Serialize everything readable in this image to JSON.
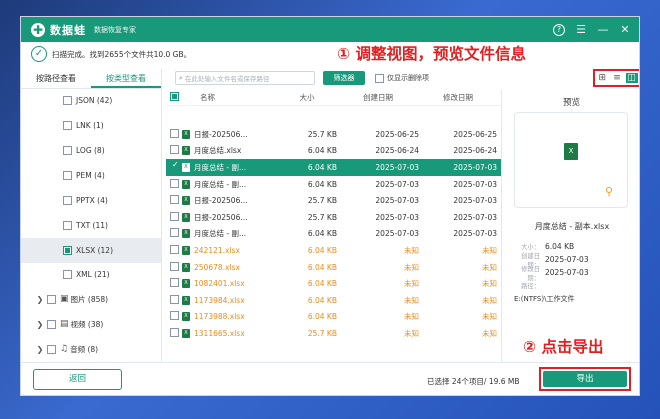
{
  "app": {
    "name": "数据蛙",
    "slogan": "数据恢复专家"
  },
  "scan": {
    "status": "扫描完成。找到2655个文件共10.0 GB。"
  },
  "annotations": {
    "step1": "① 调整视图，预览文件信息",
    "step2": "② 点击导出"
  },
  "left": {
    "tabs": [
      "按路径查看",
      "按类型查看"
    ],
    "items": [
      {
        "label": "JSON (42)"
      },
      {
        "label": "LNK (1)"
      },
      {
        "label": "LOG (8)"
      },
      {
        "label": "PEM (4)"
      },
      {
        "label": "PPTX (4)"
      },
      {
        "label": "TXT (11)"
      },
      {
        "label": "XLSX (12)"
      },
      {
        "label": "XML (21)"
      },
      {
        "label": "图片 (858)"
      },
      {
        "label": "视频 (38)"
      },
      {
        "label": "音频 (8)"
      }
    ]
  },
  "toolbar": {
    "search_placeholder": "在此处输入文件名或保存路径",
    "filter": "筛选器",
    "only_deleted": "仅显示删除项"
  },
  "table": {
    "headers": {
      "name": "名称",
      "size": "大小",
      "created": "创建日期",
      "modified": "修改日期"
    },
    "rows": [
      {
        "name": "日报-202506...",
        "size": "25.7 KB",
        "created": "2025-06-25",
        "modified": "2025-06-25"
      },
      {
        "name": "月度总结.xlsx",
        "size": "6.04 KB",
        "created": "2025-06-24",
        "modified": "2025-06-24"
      },
      {
        "name": "月度总结 - 副...",
        "size": "6.04 KB",
        "created": "2025-07-03",
        "modified": "2025-07-03"
      },
      {
        "name": "月度总结 - 副...",
        "size": "6.04 KB",
        "created": "2025-07-03",
        "modified": "2025-07-03"
      },
      {
        "name": "日报-202506...",
        "size": "25.7 KB",
        "created": "2025-07-03",
        "modified": "2025-07-03"
      },
      {
        "name": "日报-202506...",
        "size": "25.7 KB",
        "created": "2025-07-03",
        "modified": "2025-07-03"
      },
      {
        "name": "月度总结 - 副...",
        "size": "6.04 KB",
        "created": "2025-07-03",
        "modified": "2025-07-03"
      },
      {
        "name": "242121.xlsx",
        "size": "6.04 KB",
        "created": "未知",
        "modified": "未知"
      },
      {
        "name": "250678.xlsx",
        "size": "6.04 KB",
        "created": "未知",
        "modified": "未知"
      },
      {
        "name": "1082401.xlsx",
        "size": "6.04 KB",
        "created": "未知",
        "modified": "未知"
      },
      {
        "name": "1173984.xlsx",
        "size": "6.04 KB",
        "created": "未知",
        "modified": "未知"
      },
      {
        "name": "1173988.xlsx",
        "size": "6.04 KB",
        "created": "未知",
        "modified": "未知"
      },
      {
        "name": "1311665.xlsx",
        "size": "25.7 KB",
        "created": "未知",
        "modified": "未知"
      }
    ]
  },
  "preview": {
    "title": "预览",
    "filename": "月度总结 - 副本.xlsx",
    "size_label": "大小：",
    "size": "6.04 KB",
    "created_label": "创建日期：",
    "created": "2025-07-03",
    "modified_label": "修改日期：",
    "modified": "2025-07-03",
    "path_label": "路径：",
    "path": "E:(NTFS)\\工作文件"
  },
  "footer": {
    "back": "返回",
    "selected": "已选择 24个项目/ 19.6 MB",
    "export": "导出"
  },
  "colors": {
    "accent": "#17997a",
    "annotation": "#e02020",
    "unknown": "#f08a1c"
  }
}
